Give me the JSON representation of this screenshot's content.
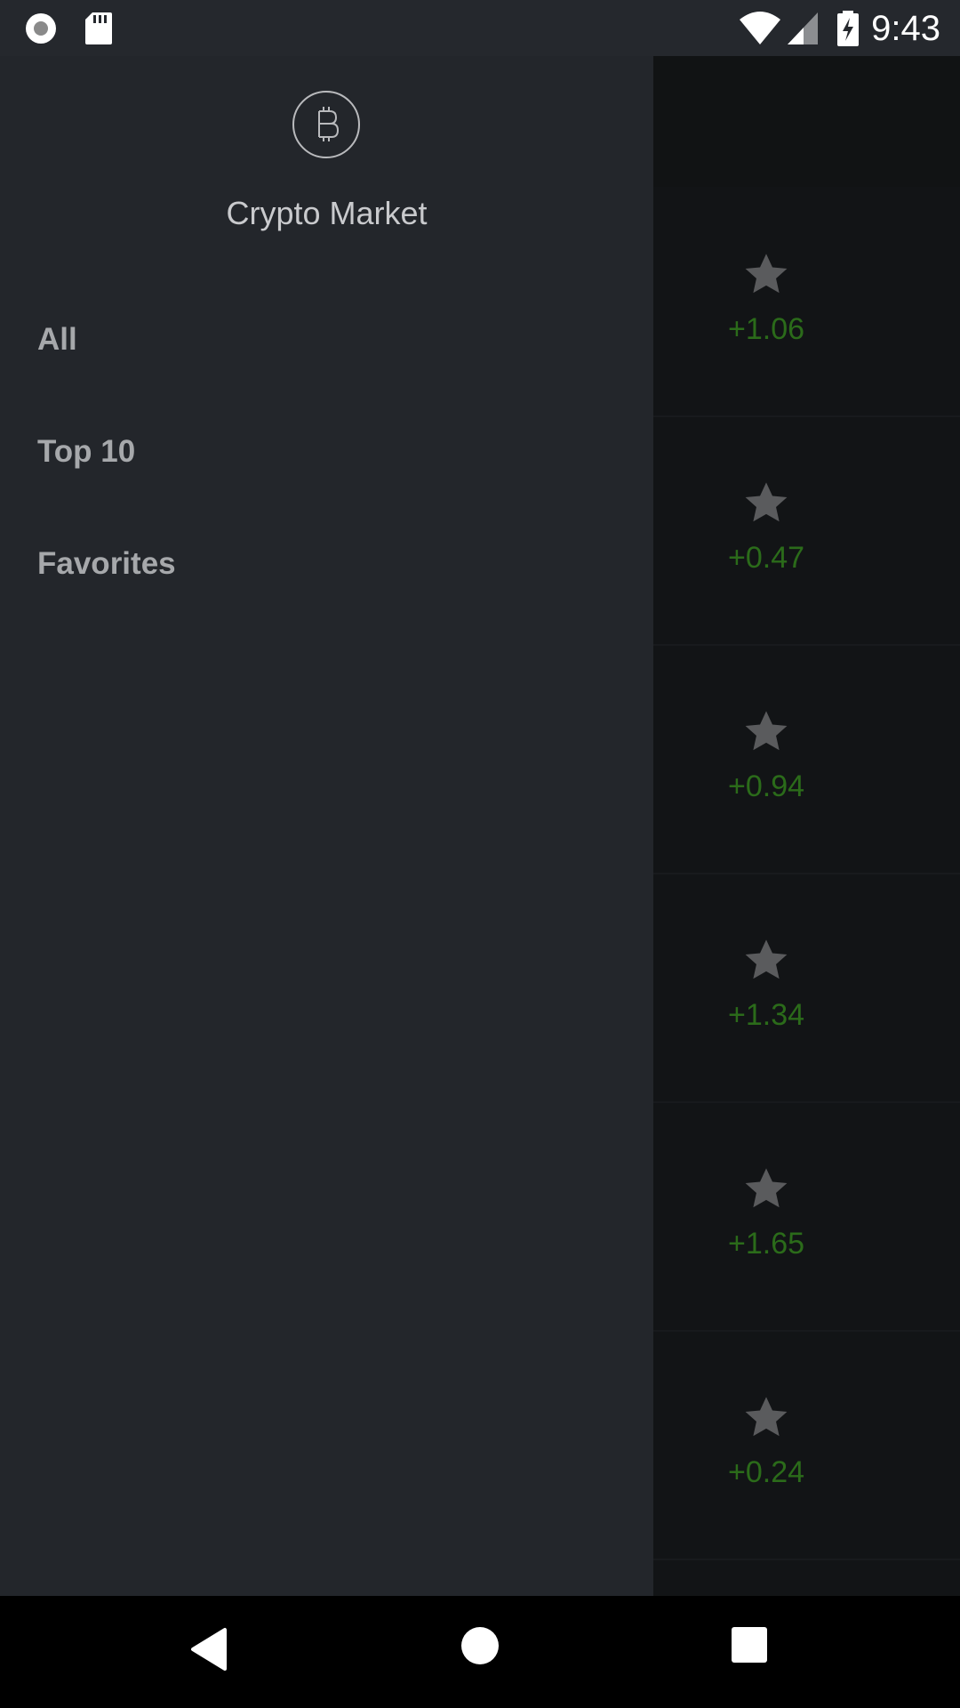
{
  "status_bar": {
    "time": "9:43",
    "left_icons": [
      "record-icon",
      "sd-card-icon"
    ],
    "right_icons": [
      "wifi-icon",
      "cell-signal-icon",
      "battery-charging-icon"
    ]
  },
  "drawer": {
    "logo_icon": "bitcoin-icon",
    "title": "Crypto Market",
    "items": [
      {
        "label": "All"
      },
      {
        "label": "Top 10"
      },
      {
        "label": "Favorites"
      }
    ]
  },
  "background_list": {
    "rows": [
      {
        "change": "+1.06",
        "favorite_icon": "star-icon"
      },
      {
        "change": "+0.47",
        "favorite_icon": "star-icon"
      },
      {
        "change": "+0.94",
        "favorite_icon": "star-icon"
      },
      {
        "change": "+1.34",
        "favorite_icon": "star-icon"
      },
      {
        "change": "+1.65",
        "favorite_icon": "star-icon"
      },
      {
        "change": "+0.24",
        "favorite_icon": "star-icon"
      }
    ]
  },
  "nav_bar": {
    "buttons": [
      "back-icon",
      "home-icon",
      "recents-icon"
    ]
  },
  "colors": {
    "drawer_bg": "#23262b",
    "positive_change": "#2b6b1a",
    "status_bar_bg": "#25282d"
  }
}
